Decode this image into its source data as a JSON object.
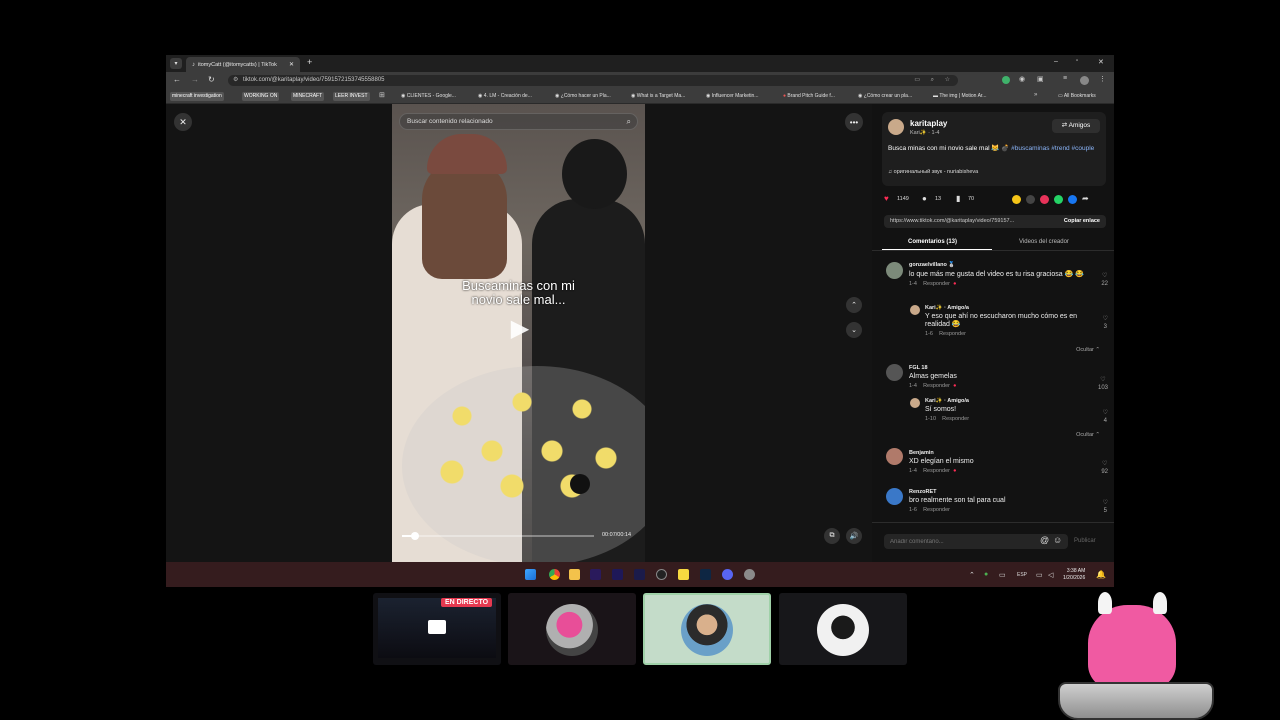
{
  "browser": {
    "tab_title": "itomyCatt (@itomycatts) | TikTok",
    "url": "tiktok.com/@karitaplay/video/7591572153745558805",
    "all_bookmarks": "All Bookmarks",
    "bookmarks": [
      {
        "label": "minecraft investigation",
        "tag": true
      },
      {
        "label": "WORKING ON",
        "tag": true
      },
      {
        "label": "MINECRAFT",
        "tag": true
      },
      {
        "label": "LEER INVEST",
        "tag": true
      },
      {
        "label": "CLIENTES - Google...",
        "tag": false
      },
      {
        "label": "4. LM - Creación de...",
        "tag": false
      },
      {
        "label": "¿Cómo hacer un Pla...",
        "tag": false
      },
      {
        "label": "What is a Target Ma...",
        "tag": false
      },
      {
        "label": "Influencer Marketin...",
        "tag": false
      },
      {
        "label": "Brand Pitch Guide f...",
        "tag": false
      },
      {
        "label": "¿Cómo crear un pla...",
        "tag": false
      },
      {
        "label": "The img | Motion Ar...",
        "tag": false
      }
    ]
  },
  "video": {
    "search_placeholder": "Buscar contenido relacionado",
    "caption_line1": "Buscaminas con mi",
    "caption_line2": "novio sale mal...",
    "time": "00:07/00:14",
    "progress": 0.07
  },
  "post": {
    "username": "karitaplay",
    "subline": "Kari✨ · 1-4",
    "follow_label": "Amigos",
    "description": "Busca minas con mi novio sale mal 😹 💣",
    "hashtags": "#buscaminas #trend #couple",
    "sound": "оригинальный звук - nuriabisheva",
    "likes": "1149",
    "comments": "13",
    "saves": "70",
    "link": "https://www.tiktok.com/@karitaplay/video/759157...",
    "copy_link": "Copiar enlace",
    "tab_comments": "Comentarios (13)",
    "tab_creator": "Videos del creador"
  },
  "comments": [
    {
      "user": "gonzaelvillano 🥈",
      "text": "lo que más me gusta del video es tu risa graciosa 😂 😂",
      "date": "1-4",
      "reply": "Responder",
      "likes": "22",
      "replies": [
        {
          "user": "Kari✨ · Amigo/a",
          "text": "Y eso que ahí no escucharon mucho cómo es en realidad 😂",
          "date": "1-6",
          "reply": "Responder",
          "likes": "3"
        }
      ],
      "hide": "Ocultar ⌃"
    },
    {
      "user": "FGL 18",
      "text": "Almas gemelas",
      "date": "1-4",
      "reply": "Responder",
      "likes": "103",
      "replies": [
        {
          "user": "Kari✨ · Amigo/a",
          "text": "Sí somos!",
          "date": "1-10",
          "reply": "Responder",
          "likes": "4"
        }
      ],
      "hide": "Ocultar ⌃"
    },
    {
      "user": "Benjamin",
      "text": "XD elegían el mismo",
      "date": "1-4",
      "reply": "Responder",
      "likes": "92",
      "replies": []
    },
    {
      "user": "RenzoRET",
      "text": "bro realmente son tal para cual",
      "date": "1-6",
      "reply": "Responder",
      "likes": "5",
      "replies": []
    }
  ],
  "composer": {
    "placeholder": "Añadir comentario...",
    "publish": "Publicar"
  },
  "taskbar": {
    "lang": "ESP",
    "time": "3:38 AM",
    "date": "1/20/2026"
  },
  "call": {
    "live_badge": "EN DIRECTO"
  },
  "colors": {
    "accent_pink": "#fe2c55",
    "hashtag": "#8ab4f8",
    "taskbar": "#351c1e"
  }
}
